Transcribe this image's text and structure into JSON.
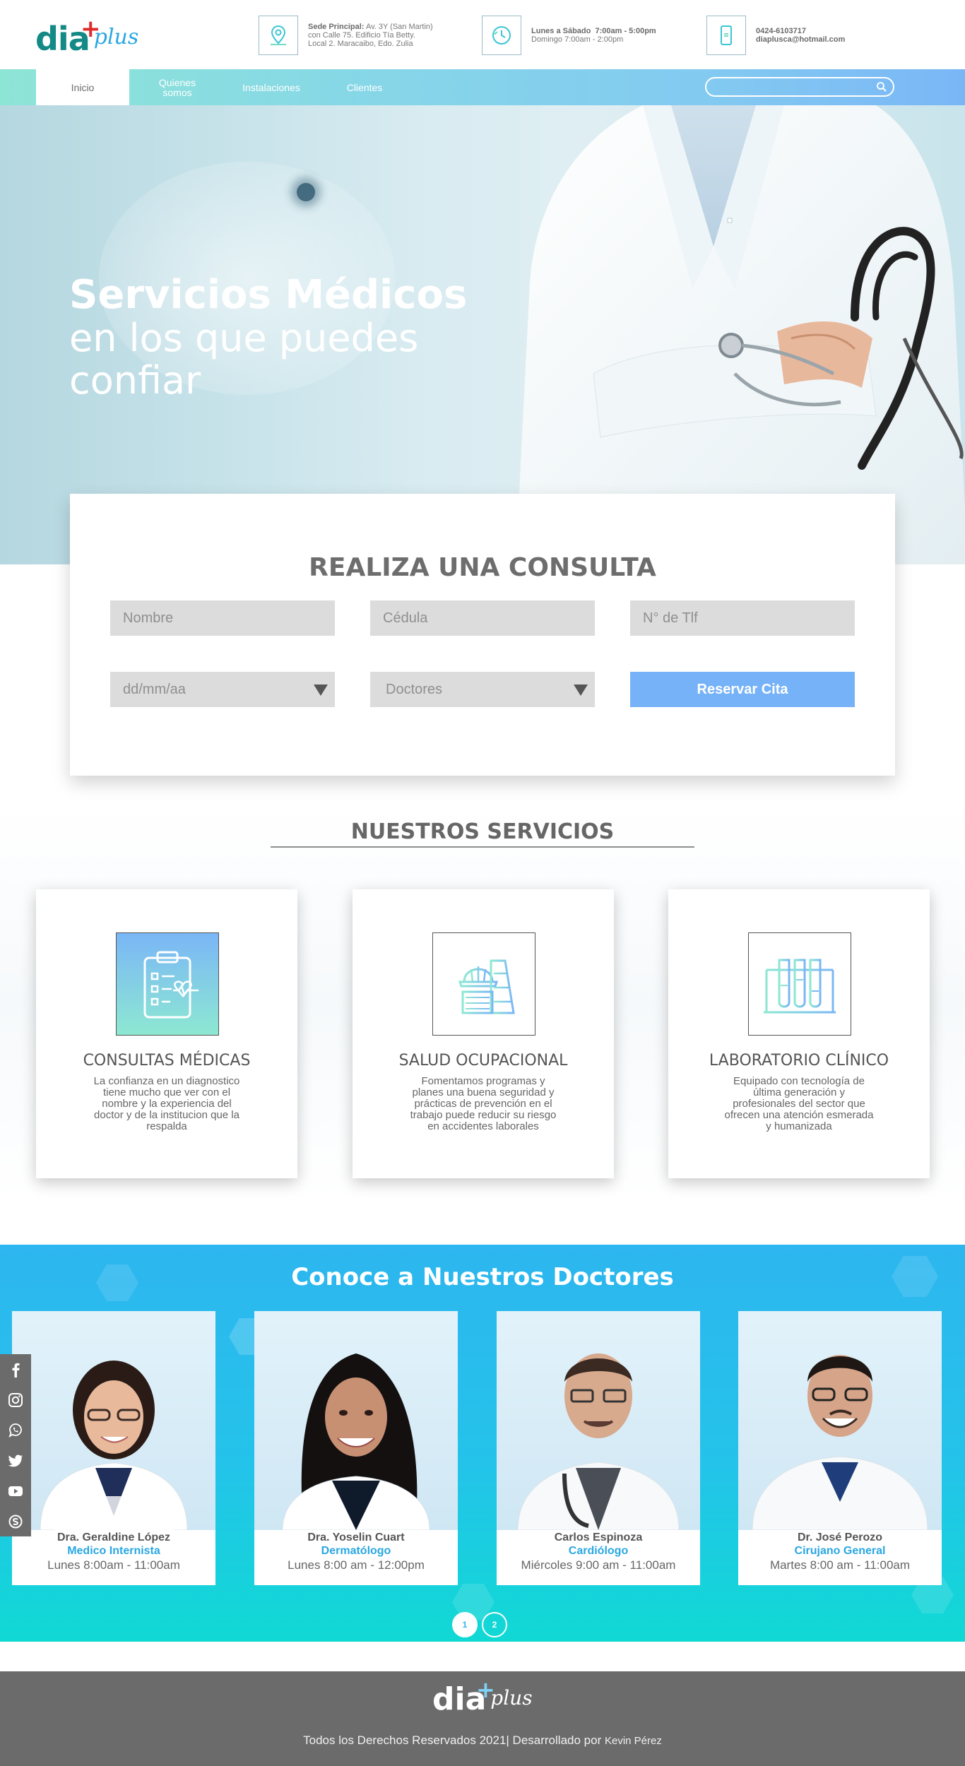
{
  "brand": {
    "logo_main": "dia",
    "logo_cross": "+",
    "logo_sub": "plus"
  },
  "header": {
    "address": {
      "label": "Sede Principal:",
      "line1": "Av. 3Y (San Martin)",
      "line2": "con Calle 75. Edificio Tía Betty.",
      "line3": "Local 2. Maracaibo, Edo. Zulia"
    },
    "schedule": {
      "label": "Lunes a Sábado",
      "line1_hours": "7:00am - 5:00pm",
      "line2": "Domingo 7:00am - 2:00pm"
    },
    "contact": {
      "phone": "0424-6103717",
      "email": "diaplusca@hotmail.com"
    }
  },
  "nav": {
    "items": [
      {
        "label": "Inicio",
        "active": true
      },
      {
        "label_line1": "Quienes",
        "label_line2": "somos"
      },
      {
        "label": "Instalaciones"
      },
      {
        "label": "Clientes"
      }
    ],
    "search_placeholder": ""
  },
  "hero": {
    "title_bold": "Servicios Médicos",
    "title_line2": "en los que puedes",
    "title_line3": "confiar"
  },
  "consulta": {
    "title": "REALIZA UNA CONSULTA",
    "fields": {
      "nombre": "Nombre",
      "cedula": "Cédula",
      "telefono": "N° de Tlf",
      "fecha": "dd/mm/aa",
      "doctores": "Doctores"
    },
    "button": "Reservar Cita"
  },
  "servicios": {
    "title": "NUESTROS SERVICIOS",
    "items": [
      {
        "name": "CONSULTAS MÉDICAS",
        "icon": "clipboard-heart-icon",
        "lines": [
          "La confianza en un diagnostico",
          "tiene mucho que ver con el",
          "nombre y la experiencia del",
          "doctor y de la institucion que la",
          "respalda"
        ]
      },
      {
        "name": "SALUD OCUPACIONAL",
        "icon": "helmet-icon",
        "lines": [
          "Fomentamos programas y",
          "planes una buena seguridad y",
          "prácticas de prevención en el",
          "trabajo puede reducir su riesgo",
          "en accidentes laborales"
        ]
      },
      {
        "name": "LABORATORIO CLÍNICO",
        "icon": "test-tubes-icon",
        "lines": [
          "Equipado con tecnología de",
          "última generación y",
          "profesionales del sector que",
          "ofrecen una atención esmerada",
          "y humanizada"
        ]
      }
    ]
  },
  "doctores": {
    "title": "Conoce a Nuestros Doctores",
    "items": [
      {
        "name": "Dra. Geraldine López",
        "specialty": "Medico Internista",
        "hours": "Lunes 8:00am - 11:00am"
      },
      {
        "name": "Dra. Yoselin Cuart",
        "specialty": "Dermatólogo",
        "hours": "Lunes 8:00 am - 12:00pm"
      },
      {
        "name": "Carlos Espinoza",
        "specialty": "Cardiólogo",
        "hours": "Miércoles 9:00 am - 11:00am"
      },
      {
        "name": "Dr. José Perozo",
        "specialty": "Cirujano General",
        "hours": "Martes 8:00 am - 11:00am"
      }
    ],
    "pages": [
      "1",
      "2"
    ],
    "current_page": "1"
  },
  "social": [
    "facebook-icon",
    "instagram-icon",
    "whatsapp-icon",
    "twitter-icon",
    "youtube-icon",
    "skype-icon"
  ],
  "footer": {
    "copyright": "Todos los Derechos Reservados 2021| Desarrollado por",
    "author": "Kevin Pérez"
  },
  "colors": {
    "brand_teal": "#138a86",
    "brand_red": "#e02a2a",
    "accent_blue": "#2aa7e2",
    "button_blue": "#76b2f7",
    "footer_gray": "#6b6b6b"
  }
}
